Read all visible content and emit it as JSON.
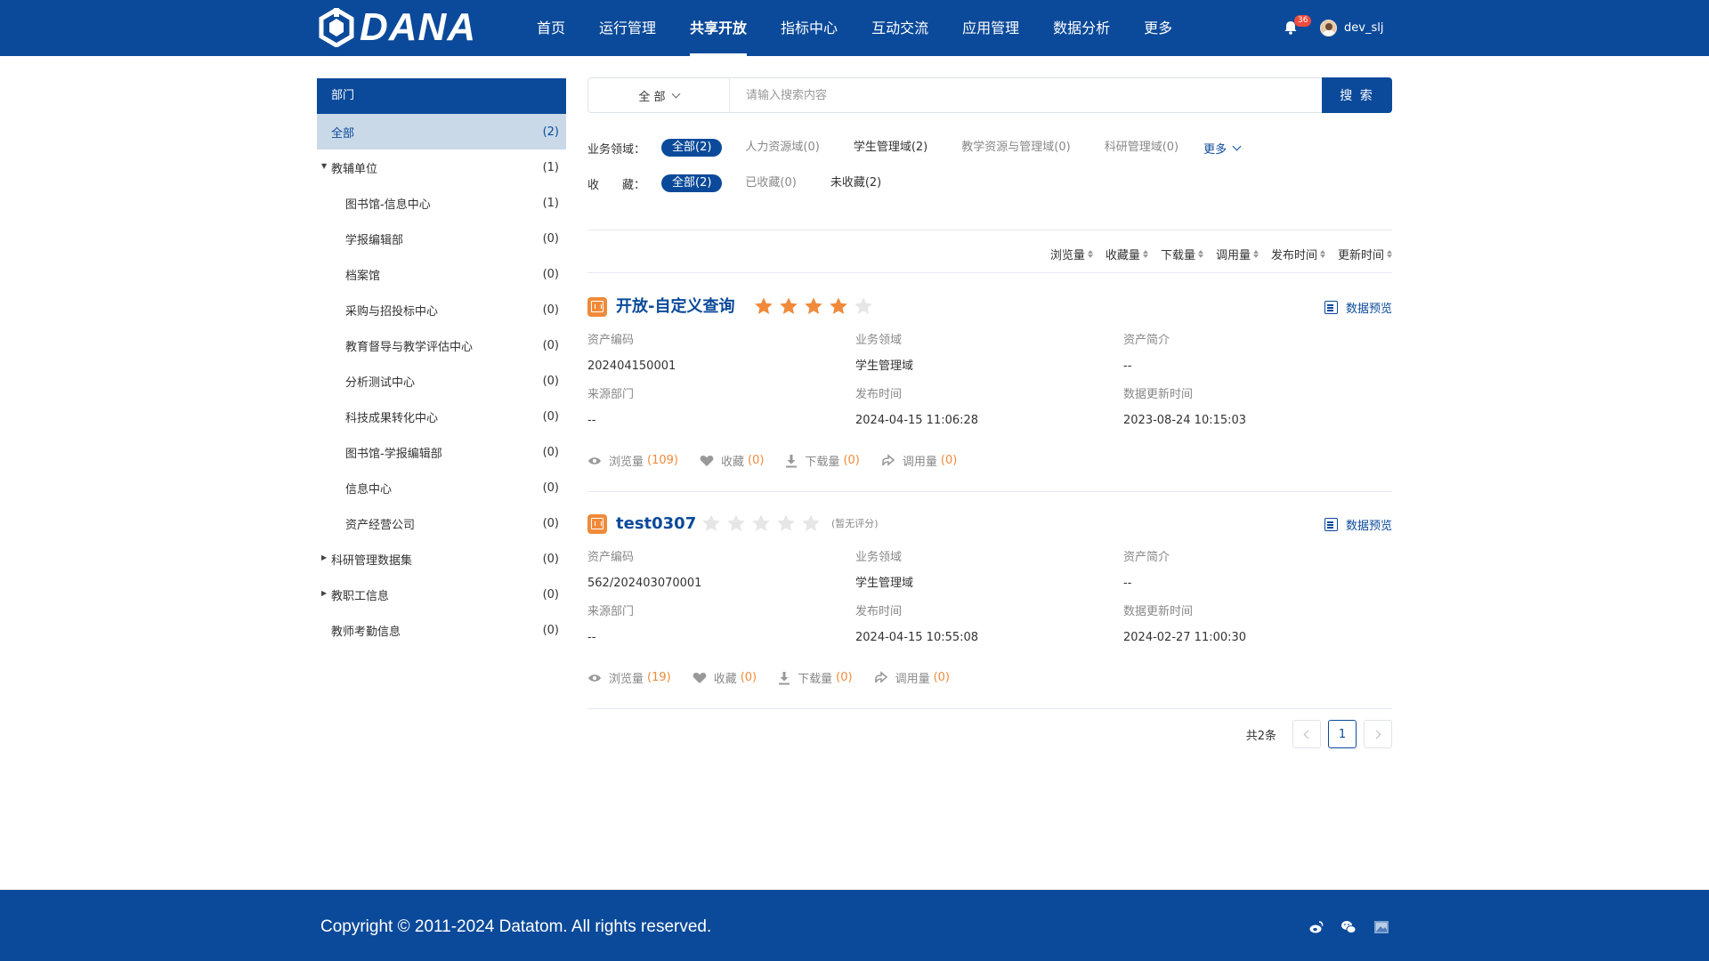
{
  "header": {
    "logo_text": "DANA",
    "nav": [
      "首页",
      "运行管理",
      "共享开放",
      "指标中心",
      "互动交流",
      "应用管理",
      "数据分析",
      "更多"
    ],
    "active_nav": 2,
    "notification_count": "36",
    "username": "dev_slj"
  },
  "sidebar": {
    "title": "部门",
    "items": [
      {
        "label": "全部",
        "count": "(2)"
      },
      {
        "label": "教辅单位",
        "count": "(1)"
      },
      {
        "label": "图书馆-信息中心",
        "count": "(1)"
      },
      {
        "label": "学报编辑部",
        "count": "(0)"
      },
      {
        "label": "档案馆",
        "count": "(0)"
      },
      {
        "label": "采购与招投标中心",
        "count": "(0)"
      },
      {
        "label": "教育督导与教学评估中心",
        "count": "(0)"
      },
      {
        "label": "分析测试中心",
        "count": "(0)"
      },
      {
        "label": "科技成果转化中心",
        "count": "(0)"
      },
      {
        "label": "图书馆-学报编辑部",
        "count": "(0)"
      },
      {
        "label": "信息中心",
        "count": "(0)"
      },
      {
        "label": "资产经营公司",
        "count": "(0)"
      },
      {
        "label": "科研管理数据集",
        "count": "(0)"
      },
      {
        "label": "教职工信息",
        "count": "(0)"
      },
      {
        "label": "教师考勤信息",
        "count": "(0)"
      }
    ]
  },
  "search": {
    "scope": "全 部",
    "placeholder": "请输入搜索内容",
    "button": "搜 索"
  },
  "filters": {
    "domain_label": "业务领域：",
    "domains": [
      "全部(2)",
      "人力资源域(0)",
      "学生管理域(2)",
      "教学资源与管理域(0)",
      "科研管理域(0)"
    ],
    "more": "更多",
    "fav_label": "收　　藏：",
    "favs": [
      "全部(2)",
      "已收藏(0)",
      "未收藏(2)"
    ]
  },
  "sort": [
    "浏览量",
    "收藏量",
    "下载量",
    "调用量",
    "发布时间",
    "更新时间"
  ],
  "field_labels": {
    "code": "资产编码",
    "domain": "业务领域",
    "intro": "资产简介",
    "source": "来源部门",
    "published": "发布时间",
    "updated": "数据更新时间"
  },
  "stat_labels": {
    "views": "浏览量",
    "fav": "收藏",
    "download": "下载量",
    "calls": "调用量"
  },
  "preview_label": "数据预览",
  "cards": [
    {
      "title": "开放-自定义查询",
      "rating": 4,
      "no_rating_text": "",
      "code": "202404150001",
      "domain": "学生管理域",
      "intro": "--",
      "source": "--",
      "published": "2024-04-15 11:06:28",
      "updated": "2023-08-24 10:15:03",
      "views": "(109)",
      "fav": "(0)",
      "download": "(0)",
      "calls": "(0)"
    },
    {
      "title": "test0307",
      "rating": 0,
      "no_rating_text": "(暂无评分)",
      "code": "562/202403070001",
      "domain": "学生管理域",
      "intro": "--",
      "source": "--",
      "published": "2024-04-15 10:55:08",
      "updated": "2024-02-27 11:00:30",
      "views": "(19)",
      "fav": "(0)",
      "download": "(0)",
      "calls": "(0)"
    }
  ],
  "pagination": {
    "total": "共2条",
    "current": "1"
  },
  "footer": {
    "copyright": "Copyright © 2011-2024 Datatom. All rights reserved."
  },
  "colors": {
    "brand": "#0b4a9a",
    "accent": "#f08a3a",
    "selected_bg": "#c9d9e8"
  }
}
